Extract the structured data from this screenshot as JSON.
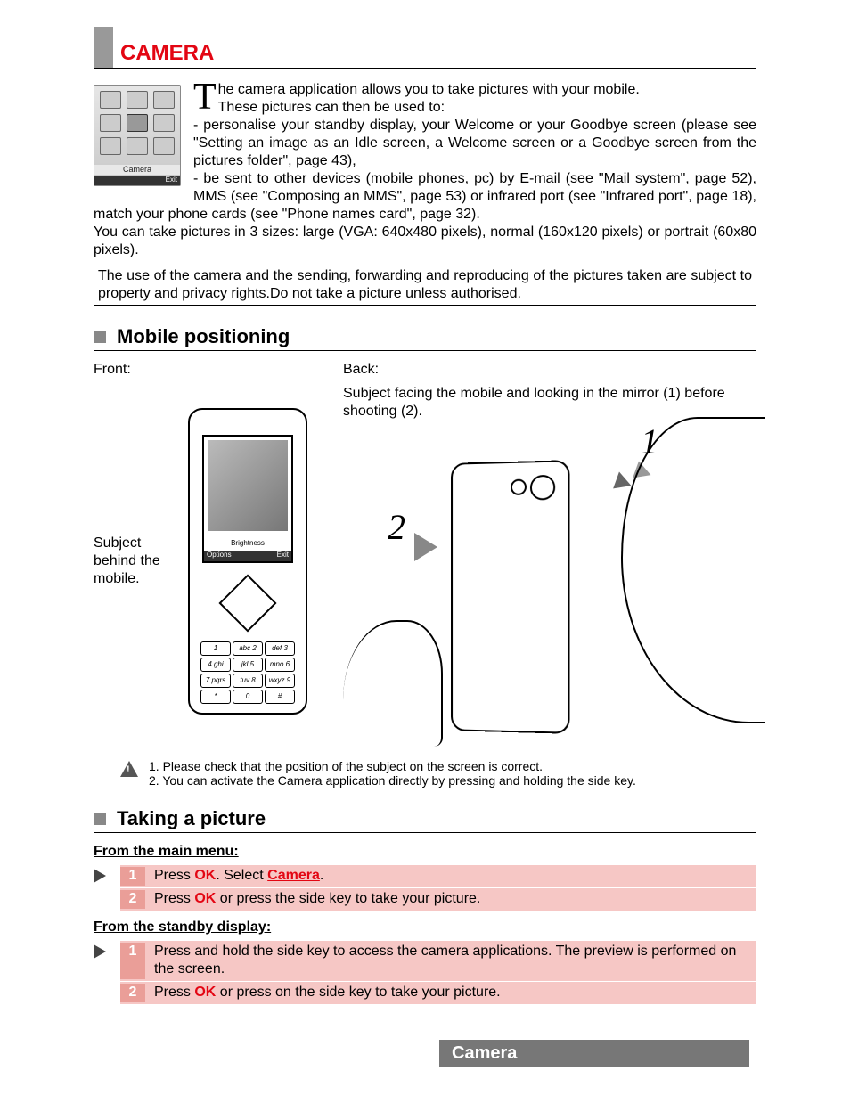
{
  "title": "CAMERA",
  "icon": {
    "label": "Camera",
    "soft_left": "",
    "soft_right": "Exit"
  },
  "intro": {
    "dropcap": "T",
    "line1a": "he camera application allows you to take pictures with your mobile.",
    "line1b": "These pictures can then be used to:",
    "bullet1": "- personalise your standby display, your Welcome or your Goodbye screen (please see \"Setting an image as an Idle screen, a Welcome screen or a Goodbye screen from the pictures folder\", page 43),",
    "bullet2": "- be sent to other devices (mobile phones, pc) by E-mail (see \"Mail system\", page 52), MMS (see \"Composing an MMS\", page 53) or infrared port (see \"Infrared port\", page 18), match your phone cards (see \"Phone names card\", page 32).",
    "sizes": "You can take pictures in 3 sizes: large (VGA: 640x480 pixels), normal (160x120 pixels) or portrait (60x80 pixels).",
    "notice": "The use of the camera and the sending, forwarding and reproducing of the pictures taken are subject to property and privacy rights.Do not take a picture unless authorised."
  },
  "sections": {
    "positioning": "Mobile positioning",
    "taking": "Taking a picture"
  },
  "positioning": {
    "front_label": "Front:",
    "back_label": "Back:",
    "front_caption": "Subject behind the mobile.",
    "back_caption": "Subject facing the mobile and looking in the mirror (1) before shooting (2).",
    "screen_brightness": "Brightness",
    "screen_opts_left": "Options",
    "screen_opts_right": "Exit",
    "annot1": "1",
    "annot2": "2",
    "keys": [
      "1",
      "abc 2",
      "def 3",
      "4 ghi",
      "jkl 5",
      "mno 6",
      "7 pqrs",
      "tuv 8",
      "wxyz 9",
      "*",
      "0",
      "#"
    ]
  },
  "warnings": {
    "w1": "1. Please check that the position of the subject on the screen is correct.",
    "w2": "2. You can activate the Camera application directly by pressing and holding the side key."
  },
  "taking": {
    "sub1": "From the main menu:",
    "s1a_pre": "Press ",
    "s1a_ok": "OK",
    "s1a_mid": ". Select ",
    "s1a_cam": "Camera",
    "s1a_post": ".",
    "s1b_pre": "Press ",
    "s1b_ok": "OK",
    "s1b_post": " or press the side key to take your picture.",
    "sub2": "From the standby display:",
    "s2a": "Press and hold the side key to access the camera applications. The preview is performed on the screen.",
    "s2b_pre": "Press ",
    "s2b_ok": "OK",
    "s2b_post": " or press on the side key to take your picture.",
    "num1": "1",
    "num2": "2"
  },
  "footer": "Camera"
}
